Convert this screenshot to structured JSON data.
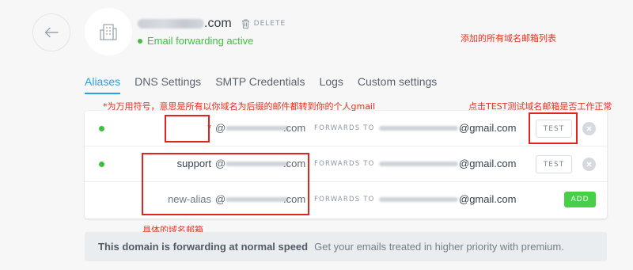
{
  "header": {
    "domain_suffix": ".com",
    "delete_label": "DELETE",
    "status_text": "Email forwarding active"
  },
  "annotations": {
    "top_right": "添加的所有域名邮箱列表",
    "wildcard_note": "*为万用符号，意思是所有以你域名为后缀的邮件都转到你的个人gmail",
    "test_note": "点击TEST测试域名邮箱是否工作正常",
    "bottom_note": "具体的域名邮箱"
  },
  "tabs": [
    {
      "label": "Aliases",
      "active": true
    },
    {
      "label": "DNS Settings",
      "active": false
    },
    {
      "label": "SMTP Credentials",
      "active": false
    },
    {
      "label": "Logs",
      "active": false
    },
    {
      "label": "Custom settings",
      "active": false
    }
  ],
  "aliases": [
    {
      "alias": "*",
      "at": "@",
      "domain_suffix": ".com",
      "forwards_label": "FORWARDS TO",
      "destination_suffix": "@gmail.com",
      "action_label": "TEST",
      "active": true
    },
    {
      "alias": "support",
      "at": "@",
      "domain_suffix": ".com",
      "forwards_label": "FORWARDS TO",
      "destination_suffix": "@gmail.com",
      "action_label": "TEST",
      "active": true
    },
    {
      "alias": "new-alias",
      "at": "@",
      "domain_suffix": ".com",
      "forwards_label": "FORWARDS TO",
      "destination_suffix": "@gmail.com",
      "action_label": "ADD",
      "active": false
    }
  ],
  "banner": {
    "bold_text": "This domain is forwarding at normal speed",
    "text": "Get your emails treated in higher priority with premium."
  },
  "colors": {
    "accent": "#27a1e6",
    "success": "#3ec23e",
    "annotation": "#e0261c"
  }
}
